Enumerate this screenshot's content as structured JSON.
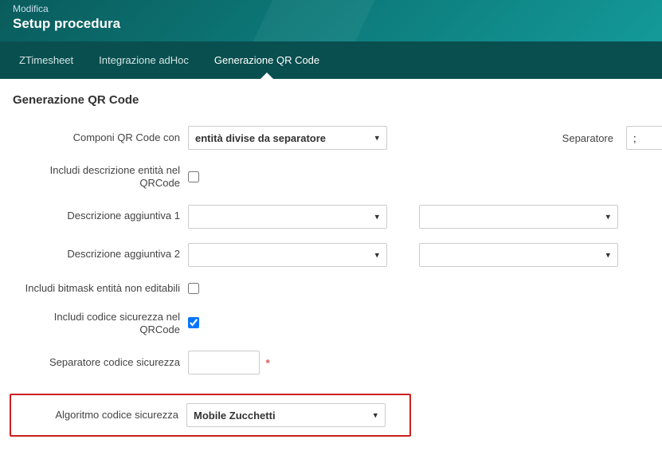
{
  "header": {
    "pre": "Modifica",
    "title": "Setup procedura"
  },
  "tabs": {
    "items": [
      {
        "label": "ZTimesheet"
      },
      {
        "label": "Integrazione adHoc"
      },
      {
        "label": "Generazione QR Code"
      }
    ],
    "activeIndex": 2
  },
  "section": {
    "title": "Generazione QR Code"
  },
  "form": {
    "compose_label": "Componi QR Code con",
    "compose_value": "entità divise da separatore",
    "separator_label": "Separatore",
    "separator_value": ";",
    "include_desc_label": "Includi descrizione entità nel QRCode",
    "include_desc_checked": false,
    "desc1_label": "Descrizione aggiuntiva 1",
    "desc1a_value": "",
    "desc1b_value": "",
    "desc2_label": "Descrizione aggiuntiva 2",
    "desc2a_value": "",
    "desc2b_value": "",
    "include_bitmask_label": "Includi bitmask entità non editabili",
    "include_bitmask_checked": false,
    "include_sec_label": "Includi codice sicurezza nel QRCode",
    "include_sec_checked": true,
    "sec_sep_label": "Separatore codice sicurezza",
    "sec_sep_value": "",
    "algo_label": "Algoritmo codice sicurezza",
    "algo_value": "Mobile Zucchetti"
  }
}
